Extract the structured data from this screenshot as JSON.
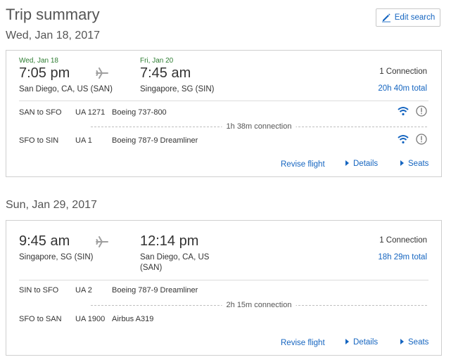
{
  "header": {
    "title": "Trip summary",
    "edit_label": "Edit search"
  },
  "trips": [
    {
      "date_heading": "Wed, Jan 18, 2017",
      "depart": {
        "date": "Wed, Jan 18",
        "time": "7:05 pm",
        "place": "San Diego, CA, US (SAN)"
      },
      "arrive": {
        "date": "Fri, Jan 20",
        "time": "7:45 am",
        "place": "Singapore, SG (SIN)"
      },
      "connections": "1 Connection",
      "total": "20h 40m total",
      "segments": [
        {
          "route": "SAN to SFO",
          "flight": "UA 1271",
          "aircraft": "Boeing 737-800",
          "wifi": true,
          "info": true
        },
        {
          "route": "SFO to SIN",
          "flight": "UA 1",
          "aircraft": "Boeing 787-9 Dreamliner",
          "wifi": true,
          "info": true
        }
      ],
      "connection_text": "1h 38m connection",
      "links": {
        "revise": "Revise flight",
        "details": "Details",
        "seats": "Seats"
      }
    },
    {
      "date_heading": "Sun, Jan 29, 2017",
      "depart": {
        "date": "",
        "time": "9:45 am",
        "place": "Singapore, SG (SIN)"
      },
      "arrive": {
        "date": "",
        "time": "12:14 pm",
        "place_line1": "San Diego, CA, US",
        "place_line2": "(SAN)"
      },
      "connections": "1 Connection",
      "total": "18h 29m total",
      "segments": [
        {
          "route": "SIN to SFO",
          "flight": "UA 2",
          "aircraft": "Boeing 787-9 Dreamliner"
        },
        {
          "route": "SFO to SAN",
          "flight": "UA 1900",
          "aircraft": "Airbus A319"
        }
      ],
      "connection_text": "2h 15m connection",
      "links": {
        "revise": "Revise flight",
        "details": "Details",
        "seats": "Seats"
      }
    }
  ],
  "colors": {
    "link": "#1565c0",
    "date_green": "#2e7d32",
    "border": "#cfcfcf"
  },
  "icons": [
    "pencil-icon",
    "airplane-icon",
    "wifi-icon",
    "info-icon",
    "triangle-right-icon"
  ]
}
